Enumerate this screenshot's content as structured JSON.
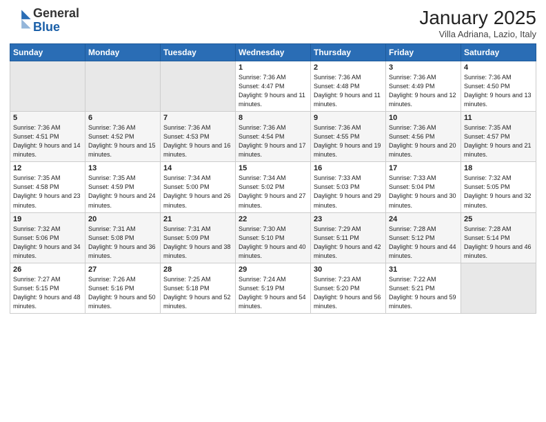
{
  "header": {
    "logo_general": "General",
    "logo_blue": "Blue",
    "month_title": "January 2025",
    "location": "Villa Adriana, Lazio, Italy"
  },
  "weekdays": [
    "Sunday",
    "Monday",
    "Tuesday",
    "Wednesday",
    "Thursday",
    "Friday",
    "Saturday"
  ],
  "weeks": [
    [
      {
        "day": "",
        "sunrise": "",
        "sunset": "",
        "daylight": ""
      },
      {
        "day": "",
        "sunrise": "",
        "sunset": "",
        "daylight": ""
      },
      {
        "day": "",
        "sunrise": "",
        "sunset": "",
        "daylight": ""
      },
      {
        "day": "1",
        "sunrise": "Sunrise: 7:36 AM",
        "sunset": "Sunset: 4:47 PM",
        "daylight": "Daylight: 9 hours and 11 minutes."
      },
      {
        "day": "2",
        "sunrise": "Sunrise: 7:36 AM",
        "sunset": "Sunset: 4:48 PM",
        "daylight": "Daylight: 9 hours and 11 minutes."
      },
      {
        "day": "3",
        "sunrise": "Sunrise: 7:36 AM",
        "sunset": "Sunset: 4:49 PM",
        "daylight": "Daylight: 9 hours and 12 minutes."
      },
      {
        "day": "4",
        "sunrise": "Sunrise: 7:36 AM",
        "sunset": "Sunset: 4:50 PM",
        "daylight": "Daylight: 9 hours and 13 minutes."
      }
    ],
    [
      {
        "day": "5",
        "sunrise": "Sunrise: 7:36 AM",
        "sunset": "Sunset: 4:51 PM",
        "daylight": "Daylight: 9 hours and 14 minutes."
      },
      {
        "day": "6",
        "sunrise": "Sunrise: 7:36 AM",
        "sunset": "Sunset: 4:52 PM",
        "daylight": "Daylight: 9 hours and 15 minutes."
      },
      {
        "day": "7",
        "sunrise": "Sunrise: 7:36 AM",
        "sunset": "Sunset: 4:53 PM",
        "daylight": "Daylight: 9 hours and 16 minutes."
      },
      {
        "day": "8",
        "sunrise": "Sunrise: 7:36 AM",
        "sunset": "Sunset: 4:54 PM",
        "daylight": "Daylight: 9 hours and 17 minutes."
      },
      {
        "day": "9",
        "sunrise": "Sunrise: 7:36 AM",
        "sunset": "Sunset: 4:55 PM",
        "daylight": "Daylight: 9 hours and 19 minutes."
      },
      {
        "day": "10",
        "sunrise": "Sunrise: 7:36 AM",
        "sunset": "Sunset: 4:56 PM",
        "daylight": "Daylight: 9 hours and 20 minutes."
      },
      {
        "day": "11",
        "sunrise": "Sunrise: 7:35 AM",
        "sunset": "Sunset: 4:57 PM",
        "daylight": "Daylight: 9 hours and 21 minutes."
      }
    ],
    [
      {
        "day": "12",
        "sunrise": "Sunrise: 7:35 AM",
        "sunset": "Sunset: 4:58 PM",
        "daylight": "Daylight: 9 hours and 23 minutes."
      },
      {
        "day": "13",
        "sunrise": "Sunrise: 7:35 AM",
        "sunset": "Sunset: 4:59 PM",
        "daylight": "Daylight: 9 hours and 24 minutes."
      },
      {
        "day": "14",
        "sunrise": "Sunrise: 7:34 AM",
        "sunset": "Sunset: 5:00 PM",
        "daylight": "Daylight: 9 hours and 26 minutes."
      },
      {
        "day": "15",
        "sunrise": "Sunrise: 7:34 AM",
        "sunset": "Sunset: 5:02 PM",
        "daylight": "Daylight: 9 hours and 27 minutes."
      },
      {
        "day": "16",
        "sunrise": "Sunrise: 7:33 AM",
        "sunset": "Sunset: 5:03 PM",
        "daylight": "Daylight: 9 hours and 29 minutes."
      },
      {
        "day": "17",
        "sunrise": "Sunrise: 7:33 AM",
        "sunset": "Sunset: 5:04 PM",
        "daylight": "Daylight: 9 hours and 30 minutes."
      },
      {
        "day": "18",
        "sunrise": "Sunrise: 7:32 AM",
        "sunset": "Sunset: 5:05 PM",
        "daylight": "Daylight: 9 hours and 32 minutes."
      }
    ],
    [
      {
        "day": "19",
        "sunrise": "Sunrise: 7:32 AM",
        "sunset": "Sunset: 5:06 PM",
        "daylight": "Daylight: 9 hours and 34 minutes."
      },
      {
        "day": "20",
        "sunrise": "Sunrise: 7:31 AM",
        "sunset": "Sunset: 5:08 PM",
        "daylight": "Daylight: 9 hours and 36 minutes."
      },
      {
        "day": "21",
        "sunrise": "Sunrise: 7:31 AM",
        "sunset": "Sunset: 5:09 PM",
        "daylight": "Daylight: 9 hours and 38 minutes."
      },
      {
        "day": "22",
        "sunrise": "Sunrise: 7:30 AM",
        "sunset": "Sunset: 5:10 PM",
        "daylight": "Daylight: 9 hours and 40 minutes."
      },
      {
        "day": "23",
        "sunrise": "Sunrise: 7:29 AM",
        "sunset": "Sunset: 5:11 PM",
        "daylight": "Daylight: 9 hours and 42 minutes."
      },
      {
        "day": "24",
        "sunrise": "Sunrise: 7:28 AM",
        "sunset": "Sunset: 5:12 PM",
        "daylight": "Daylight: 9 hours and 44 minutes."
      },
      {
        "day": "25",
        "sunrise": "Sunrise: 7:28 AM",
        "sunset": "Sunset: 5:14 PM",
        "daylight": "Daylight: 9 hours and 46 minutes."
      }
    ],
    [
      {
        "day": "26",
        "sunrise": "Sunrise: 7:27 AM",
        "sunset": "Sunset: 5:15 PM",
        "daylight": "Daylight: 9 hours and 48 minutes."
      },
      {
        "day": "27",
        "sunrise": "Sunrise: 7:26 AM",
        "sunset": "Sunset: 5:16 PM",
        "daylight": "Daylight: 9 hours and 50 minutes."
      },
      {
        "day": "28",
        "sunrise": "Sunrise: 7:25 AM",
        "sunset": "Sunset: 5:18 PM",
        "daylight": "Daylight: 9 hours and 52 minutes."
      },
      {
        "day": "29",
        "sunrise": "Sunrise: 7:24 AM",
        "sunset": "Sunset: 5:19 PM",
        "daylight": "Daylight: 9 hours and 54 minutes."
      },
      {
        "day": "30",
        "sunrise": "Sunrise: 7:23 AM",
        "sunset": "Sunset: 5:20 PM",
        "daylight": "Daylight: 9 hours and 56 minutes."
      },
      {
        "day": "31",
        "sunrise": "Sunrise: 7:22 AM",
        "sunset": "Sunset: 5:21 PM",
        "daylight": "Daylight: 9 hours and 59 minutes."
      },
      {
        "day": "",
        "sunrise": "",
        "sunset": "",
        "daylight": ""
      }
    ]
  ]
}
